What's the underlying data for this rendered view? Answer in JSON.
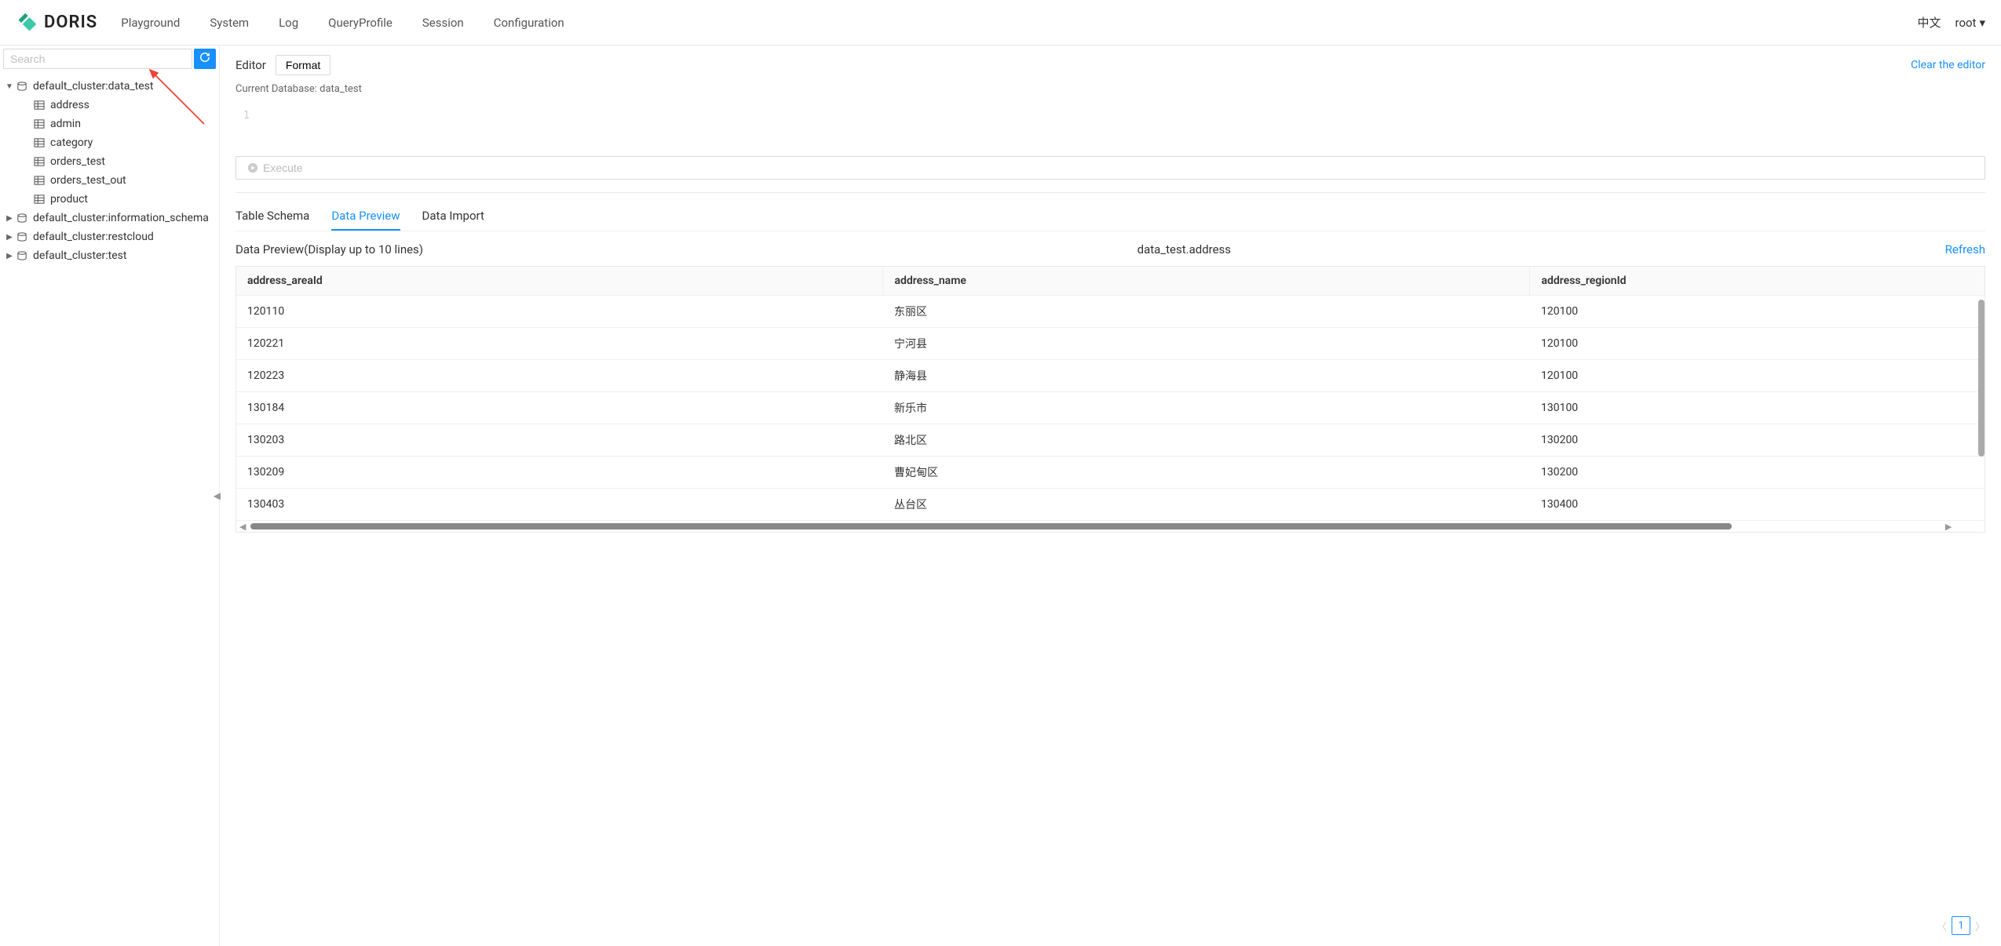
{
  "brand": "DORIS",
  "nav": {
    "playground": "Playground",
    "system": "System",
    "log": "Log",
    "queryprofile": "QueryProfile",
    "session": "Session",
    "configuration": "Configuration"
  },
  "header": {
    "lang": "中文",
    "user": "root"
  },
  "sidebar": {
    "search_placeholder": "Search",
    "db0": "default_cluster:data_test",
    "tables": {
      "t0": "address",
      "t1": "admin",
      "t2": "category",
      "t3": "orders_test",
      "t4": "orders_test_out",
      "t5": "product"
    },
    "db1": "default_cluster:information_schema",
    "db2": "default_cluster:restcloud",
    "db3": "default_cluster:test"
  },
  "editor": {
    "label": "Editor",
    "format": "Format",
    "clear": "Clear the editor",
    "current_db": "Current Database: data_test",
    "line": "1",
    "execute": "Execute"
  },
  "tabs": {
    "schema": "Table Schema",
    "preview": "Data Preview",
    "import": "Data Import"
  },
  "preview": {
    "title": "Data Preview(Display up to 10 lines)",
    "table_ref": "data_test.address",
    "refresh": "Refresh",
    "col0": "address_areaId",
    "col1": "address_name",
    "col2": "address_regionId",
    "rows": [
      {
        "c0": "120110",
        "c1": "东丽区",
        "c2": "120100"
      },
      {
        "c0": "120221",
        "c1": "宁河县",
        "c2": "120100"
      },
      {
        "c0": "120223",
        "c1": "静海县",
        "c2": "120100"
      },
      {
        "c0": "130184",
        "c1": "新乐市",
        "c2": "130100"
      },
      {
        "c0": "130203",
        "c1": "路北区",
        "c2": "130200"
      },
      {
        "c0": "130209",
        "c1": "曹妃甸区",
        "c2": "130200"
      },
      {
        "c0": "130403",
        "c1": "丛台区",
        "c2": "130400"
      }
    ]
  },
  "pager": {
    "page": "1"
  }
}
